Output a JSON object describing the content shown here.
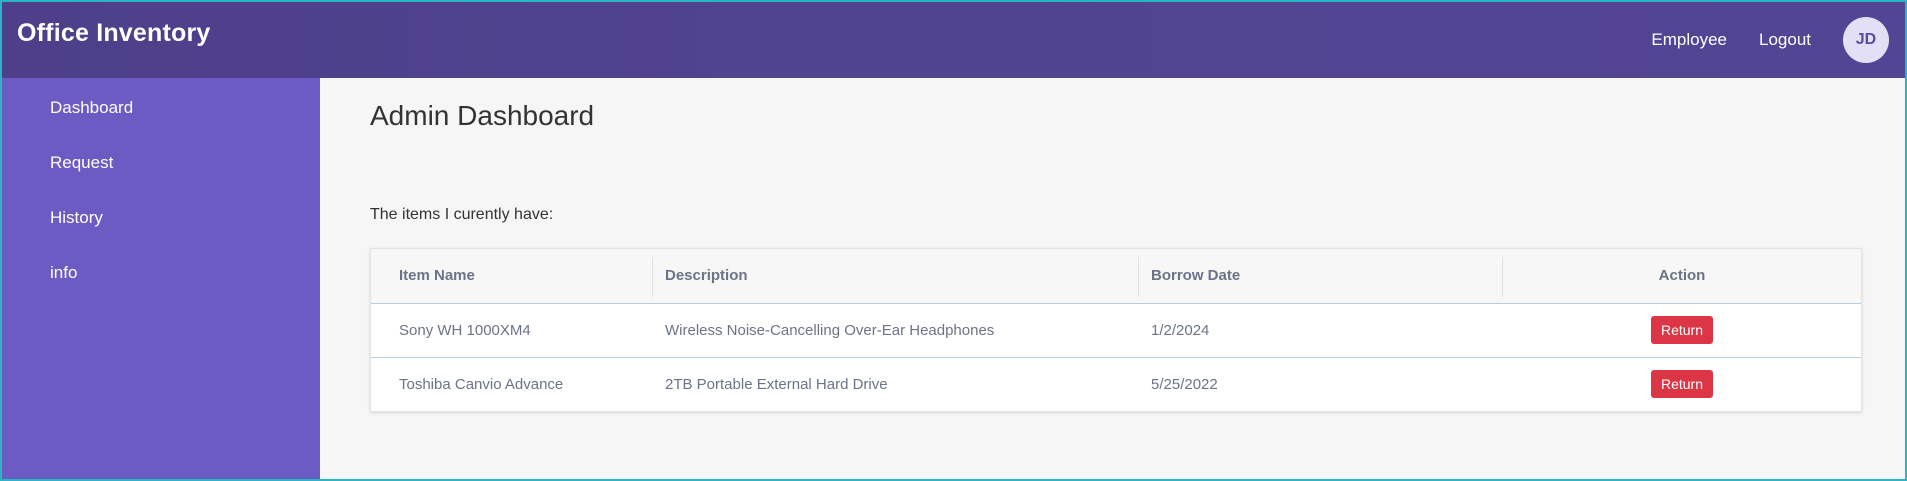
{
  "app": {
    "title": "Office Inventory"
  },
  "topnav": {
    "employee_label": "Employee",
    "logout_label": "Logout",
    "avatar_initials": "JD"
  },
  "sidebar": {
    "items": [
      {
        "label": "Dashboard"
      },
      {
        "label": "Request"
      },
      {
        "label": "History"
      },
      {
        "label": "info"
      }
    ]
  },
  "main": {
    "title": "Admin Dashboard",
    "subtitle": "The items I curently have:",
    "table": {
      "headers": [
        "Item Name",
        "Description",
        "Borrow Date",
        "Action"
      ],
      "rows": [
        {
          "item": "Sony WH 1000XM4",
          "description": "Wireless Noise-Cancelling Over-Ear Headphones",
          "date": "1/2/2024",
          "action": "Return"
        },
        {
          "item": "Toshiba Canvio Advance",
          "description": "2TB Portable External Hard Drive",
          "date": "5/25/2022",
          "action": "Return"
        }
      ]
    }
  },
  "colors": {
    "topbar": "#4d3f8a",
    "sidebar": "#6b5bc2",
    "return_button": "#dc3545",
    "border": "#2bb3c6"
  }
}
